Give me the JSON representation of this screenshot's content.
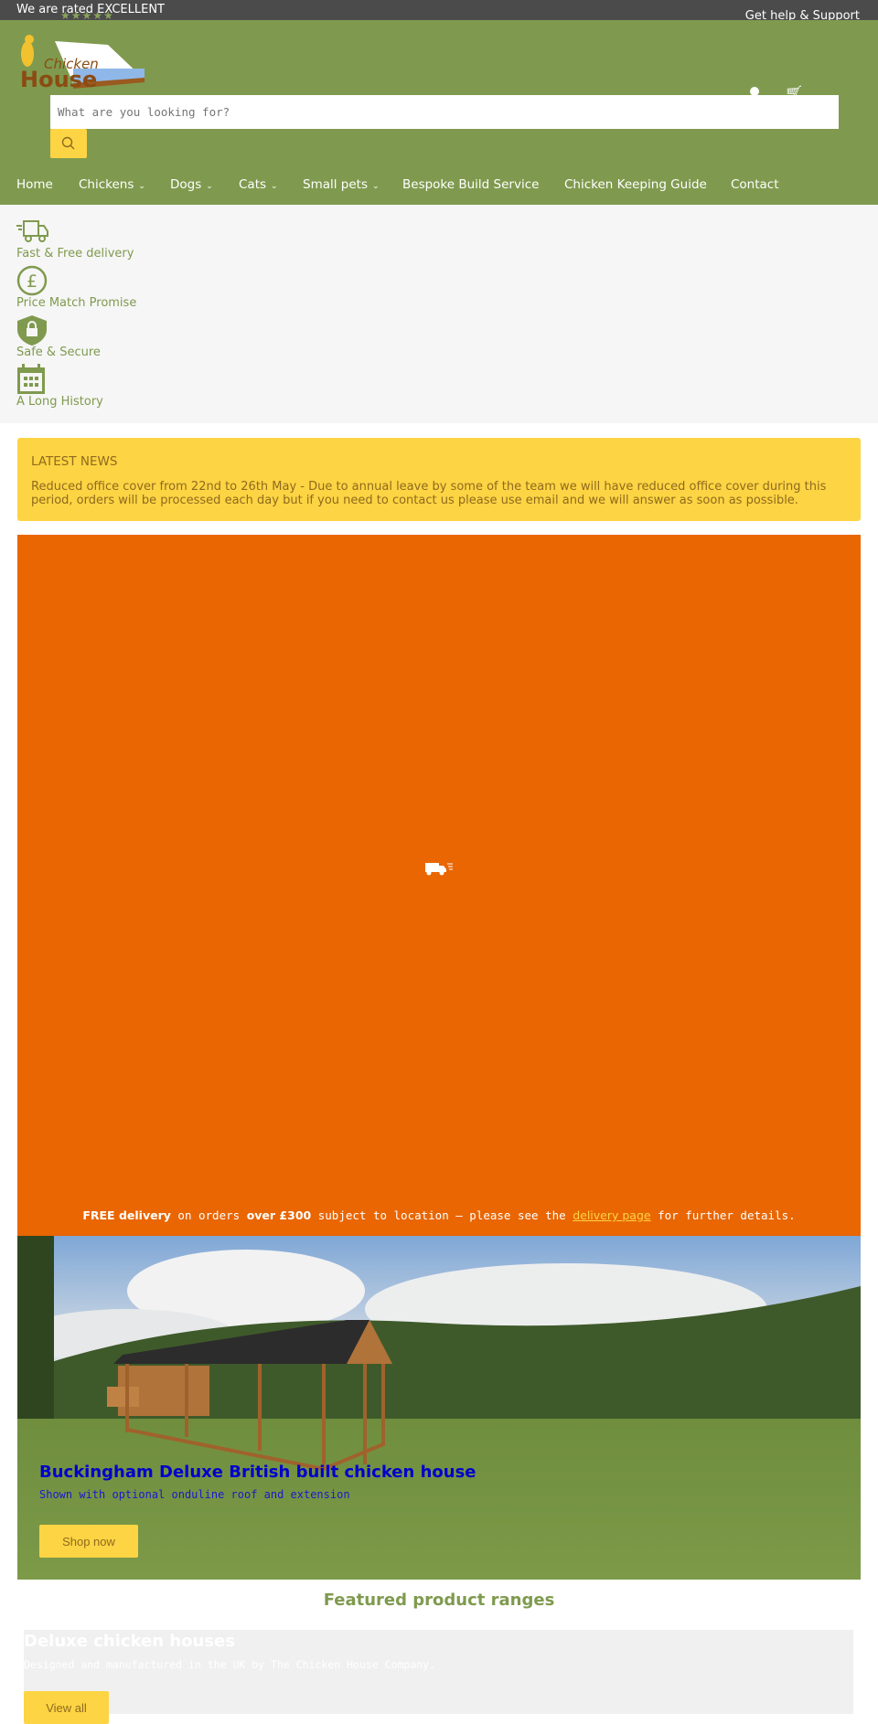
{
  "topbar": {
    "rating_text": "We are rated EXCELLENT",
    "stars": 5,
    "help_link": "Get help & Support"
  },
  "header": {
    "logo_text": "Chicken House",
    "search": {
      "placeholder": "What are you looking for?"
    }
  },
  "nav": {
    "items": [
      {
        "label": "Home"
      },
      {
        "label": "Chickens",
        "dropdown": true
      },
      {
        "label": "Dogs",
        "dropdown": true
      },
      {
        "label": "Cats",
        "dropdown": true
      },
      {
        "label": "Small pets",
        "dropdown": true
      },
      {
        "label": "Bespoke Build Service"
      },
      {
        "label": "Chicken Keeping Guide"
      },
      {
        "label": "Contact"
      }
    ]
  },
  "features": [
    {
      "icon": "truck-icon",
      "label": "Fast & Free delivery"
    },
    {
      "icon": "pound-icon",
      "label": "Price Match Promise"
    },
    {
      "icon": "shield-lock-icon",
      "label": "Safe & Secure"
    },
    {
      "icon": "calendar-icon",
      "label": "A Long History"
    }
  ],
  "news": {
    "title": "LATEST NEWS",
    "body": "Reduced office cover from 22nd to 26th May - Due to annual leave by some of the team we will have reduced office cover during this period, orders will be processed each day but if you need to contact us please use email and we will answer as soon as possible."
  },
  "promo": {
    "free_delivery": "FREE delivery",
    "t1": " on orders ",
    "over": "over £300",
    "t2": " subject to location – please see the ",
    "link": "delivery page",
    "t3": " for further details."
  },
  "hero": {
    "title": "Buckingham Deluxe British built chicken house",
    "subtitle": "Shown with optional onduline roof and extension",
    "button": "Shop now"
  },
  "featured": {
    "heading": "Featured product ranges",
    "card": {
      "title": "Deluxe chicken houses",
      "subtitle": "Designed and manufactured in the UK by The Chicken House Company.",
      "button": "View all"
    }
  },
  "colors": {
    "brand_green": "#7f9a4e",
    "accent_yellow": "#fdd443",
    "promo_orange": "#e96603",
    "topbar": "#4b4b4b"
  }
}
